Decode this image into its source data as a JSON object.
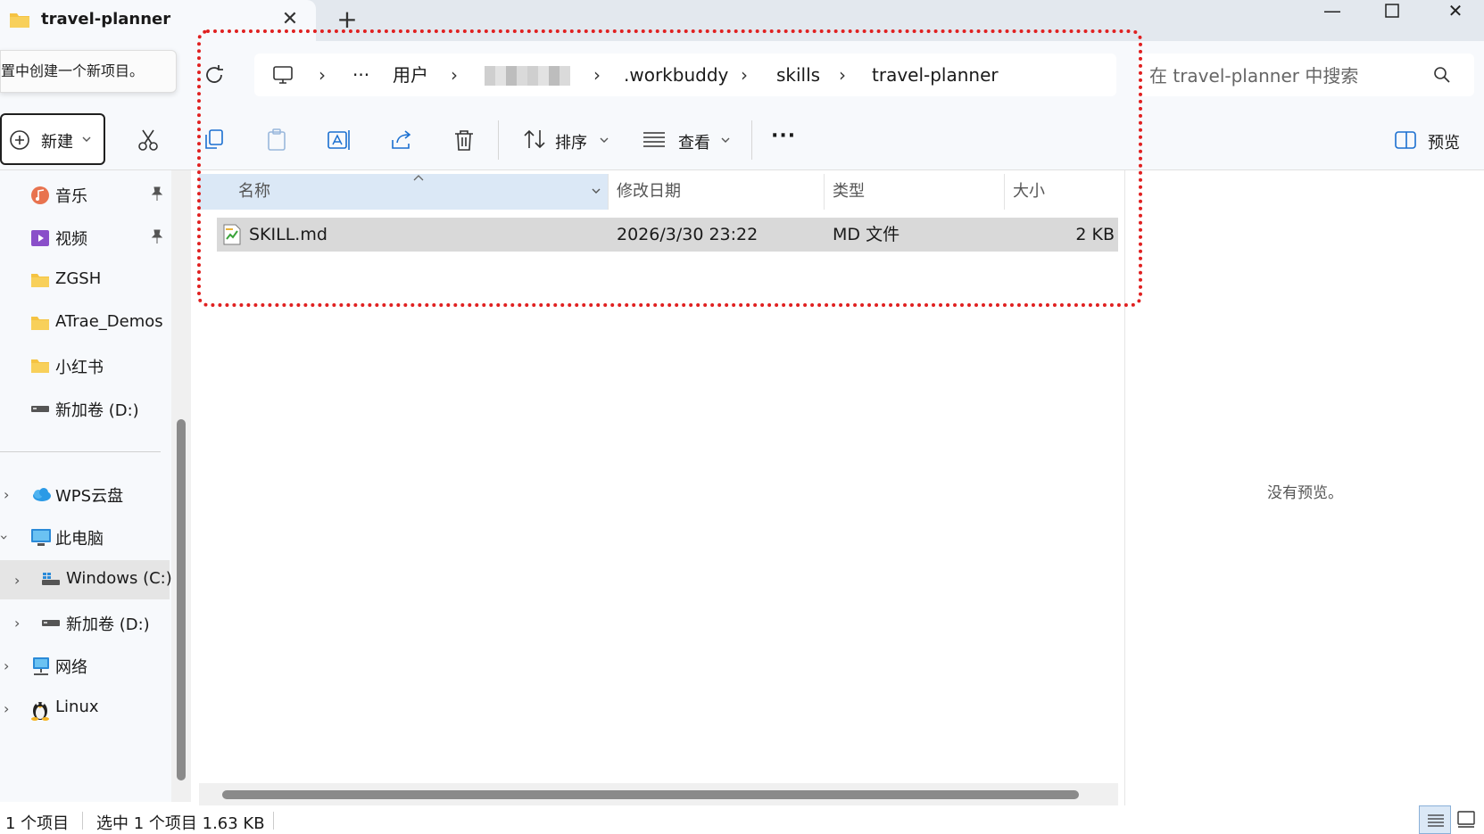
{
  "window": {
    "tab_title": "travel-planner",
    "tab_close": "✕",
    "tab_add": "+",
    "minimize": "—",
    "close": "✕"
  },
  "tooltip": "置中创建一个新项目。",
  "breadcrumb": {
    "ellipsis": "···",
    "items": [
      "用户",
      ".workbuddy",
      "skills",
      "travel-planner"
    ],
    "separator": "›"
  },
  "search": {
    "placeholder": "在 travel-planner 中搜索"
  },
  "toolbar": {
    "new_label": "新建",
    "sort_label": "排序",
    "view_label": "查看",
    "more_label": "···",
    "preview_label": "预览"
  },
  "sidebar": {
    "quick_access": [
      {
        "label": "音乐",
        "icon": "music-icon",
        "pinned": true
      },
      {
        "label": "视频",
        "icon": "video-icon",
        "pinned": true
      },
      {
        "label": "ZGSH",
        "icon": "folder-icon",
        "pinned": false
      },
      {
        "label": "ATrae_Demos",
        "icon": "folder-icon",
        "pinned": false
      },
      {
        "label": "小红书",
        "icon": "folder-icon",
        "pinned": false
      },
      {
        "label": "新加卷 (D:)",
        "icon": "drive-icon",
        "pinned": false
      }
    ],
    "tree": [
      {
        "label": "WPS云盘",
        "icon": "cloud-icon"
      },
      {
        "label": "此电脑",
        "icon": "computer-icon"
      },
      {
        "label": "Windows (C:)",
        "icon": "windows-drive-icon"
      },
      {
        "label": "新加卷 (D:)",
        "icon": "drive-icon"
      },
      {
        "label": "网络",
        "icon": "network-icon"
      },
      {
        "label": "Linux",
        "icon": "linux-icon"
      }
    ]
  },
  "columns": {
    "name": "名称",
    "modified": "修改日期",
    "type": "类型",
    "size": "大小"
  },
  "files": [
    {
      "name": "SKILL.md",
      "modified": "2026/3/30 23:22",
      "type": "MD 文件",
      "size": "2 KB"
    }
  ],
  "preview": {
    "empty_text": "没有预览。"
  },
  "status": {
    "count": "1 个项目",
    "selected": "选中 1 个项目  1.63 KB"
  },
  "colors": {
    "annotation": "#e02020",
    "selection": "#d9d9d9",
    "header_highlight": "#dbe8f6"
  }
}
